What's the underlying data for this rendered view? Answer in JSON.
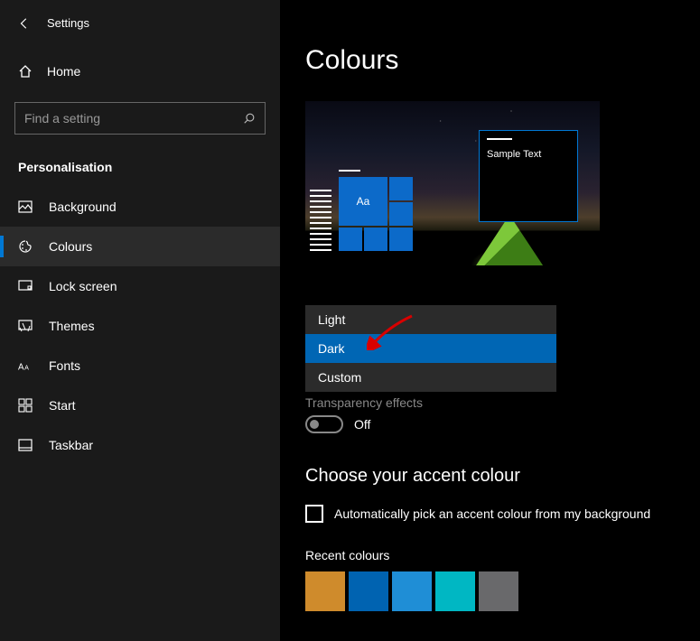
{
  "header": {
    "title": "Settings"
  },
  "home": {
    "label": "Home"
  },
  "search": {
    "placeholder": "Find a setting"
  },
  "category": {
    "label": "Personalisation"
  },
  "nav": {
    "items": [
      {
        "label": "Background"
      },
      {
        "label": "Colours"
      },
      {
        "label": "Lock screen"
      },
      {
        "label": "Themes"
      },
      {
        "label": "Fonts"
      },
      {
        "label": "Start"
      },
      {
        "label": "Taskbar"
      }
    ]
  },
  "main": {
    "title": "Colours",
    "preview": {
      "sample_text": "Sample Text",
      "aa": "Aa"
    },
    "mode_dropdown": {
      "options": [
        {
          "label": "Light"
        },
        {
          "label": "Dark"
        },
        {
          "label": "Custom"
        }
      ]
    },
    "transparency": {
      "label": "Transparency effects",
      "state": "Off"
    },
    "accent": {
      "title": "Choose your accent colour",
      "auto_label": "Automatically pick an accent colour from my background",
      "recent_label": "Recent colours",
      "swatches": [
        "#cf8b2c",
        "#0063b1",
        "#1f8ed6",
        "#00b7c3",
        "#69696b"
      ]
    }
  }
}
